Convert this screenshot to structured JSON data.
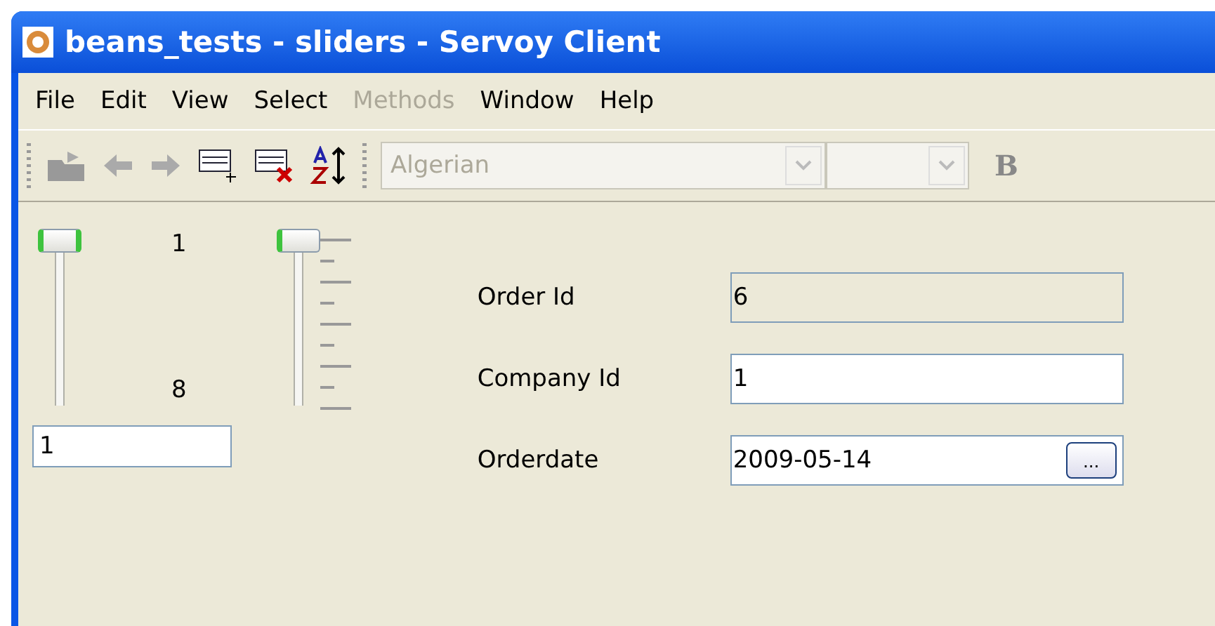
{
  "window": {
    "title": "beans_tests - sliders - Servoy Client"
  },
  "menu": [
    {
      "label": "File",
      "disabled": false
    },
    {
      "label": "Edit",
      "disabled": false
    },
    {
      "label": "View",
      "disabled": false
    },
    {
      "label": "Select",
      "disabled": false
    },
    {
      "label": "Methods",
      "disabled": true
    },
    {
      "label": "Window",
      "disabled": false
    },
    {
      "label": "Help",
      "disabled": false
    }
  ],
  "toolbar": {
    "font": {
      "value": "Algerian",
      "disabled": true
    },
    "bold": "B"
  },
  "sliders": [
    {
      "kind": "plain",
      "level": 1,
      "top_label": "1",
      "bottom_label": "8"
    },
    {
      "kind": "ticks",
      "level": 1
    }
  ],
  "slider_value": "1",
  "fields": [
    {
      "label": "Order Id",
      "value": "6",
      "kind": "readonly"
    },
    {
      "label": "Company Id",
      "value": "1",
      "kind": "text"
    },
    {
      "label": "Orderdate",
      "value": "2009-05-14",
      "kind": "date",
      "button": "..."
    }
  ]
}
